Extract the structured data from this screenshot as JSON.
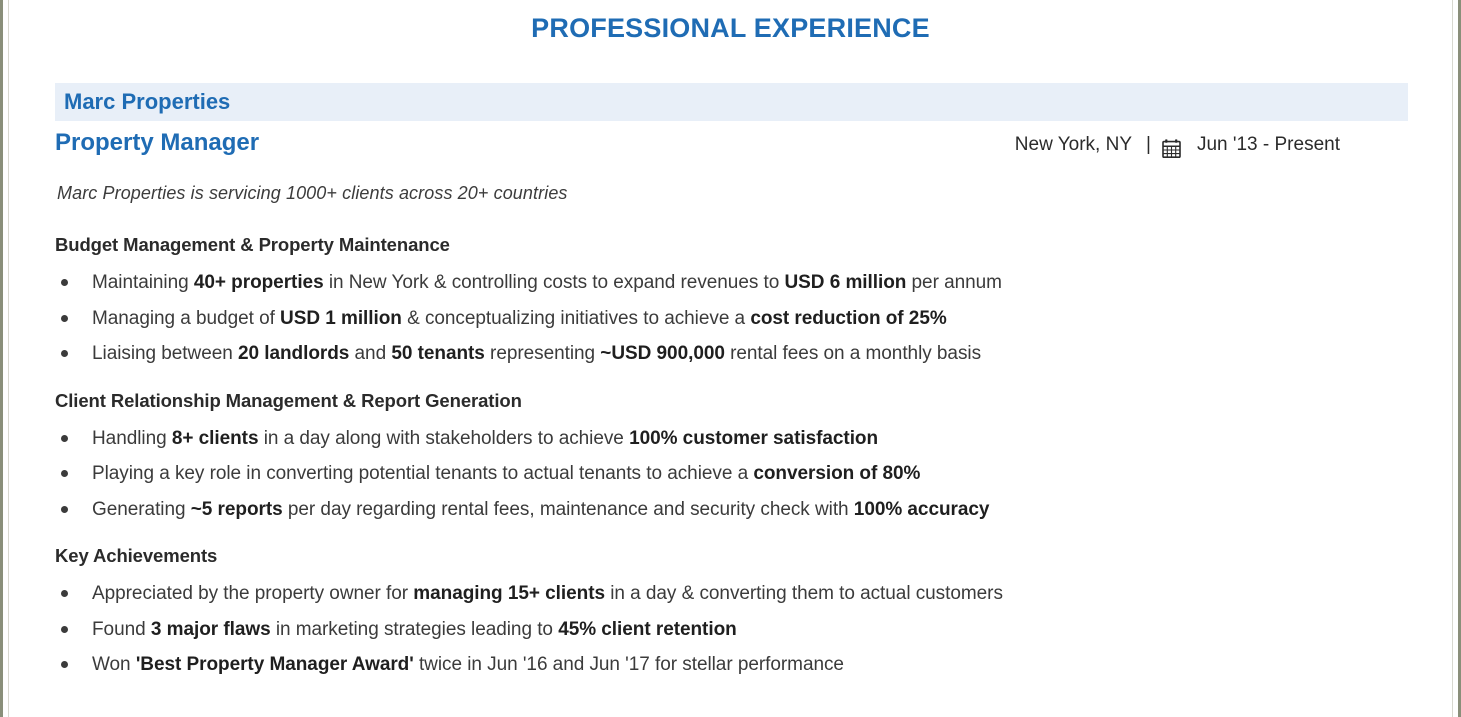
{
  "document": {
    "section_title": "PROFESSIONAL EXPERIENCE",
    "accent_color": "#1f6cb4",
    "company_bar_color": "#e8eff8",
    "company": "Marc Properties",
    "role": "Property Manager",
    "location": "New York, NY",
    "separator": "|",
    "calendar_icon": "calendar-icon",
    "dates": "Jun '13 -  Present",
    "tagline": "Marc Properties is servicing 1000+ clients across 20+ countries",
    "blocks": [
      {
        "heading": "Budget Management & Property Maintenance",
        "bullets": [
          [
            {
              "t": "Maintaining ",
              "b": false
            },
            {
              "t": "40+ properties",
              "b": true
            },
            {
              "t": " in New York & controlling costs to expand revenues to ",
              "b": false
            },
            {
              "t": "USD 6 million",
              "b": true
            },
            {
              "t": " per annum",
              "b": false
            }
          ],
          [
            {
              "t": "Managing a budget of ",
              "b": false
            },
            {
              "t": "USD 1 million",
              "b": true
            },
            {
              "t": " & conceptualizing initiatives to achieve a ",
              "b": false
            },
            {
              "t": "cost reduction of 25%",
              "b": true
            }
          ],
          [
            {
              "t": "Liaising between ",
              "b": false
            },
            {
              "t": "20 landlords",
              "b": true
            },
            {
              "t": " and ",
              "b": false
            },
            {
              "t": "50 tenants",
              "b": true
            },
            {
              "t": " representing ",
              "b": false
            },
            {
              "t": "~USD 900,000",
              "b": true
            },
            {
              "t": " rental fees on a monthly basis",
              "b": false
            }
          ]
        ]
      },
      {
        "heading": "Client Relationship Management & Report Generation",
        "bullets": [
          [
            {
              "t": "Handling ",
              "b": false
            },
            {
              "t": "8+ clients",
              "b": true
            },
            {
              "t": " in a day along with stakeholders to achieve ",
              "b": false
            },
            {
              "t": "100% customer satisfaction",
              "b": true
            }
          ],
          [
            {
              "t": "Playing a key role in converting potential tenants to actual tenants to achieve a ",
              "b": false
            },
            {
              "t": "conversion of 80%",
              "b": true
            }
          ],
          [
            {
              "t": "Generating ",
              "b": false
            },
            {
              "t": "~5 reports",
              "b": true
            },
            {
              "t": " per day regarding rental fees, maintenance and security check with ",
              "b": false
            },
            {
              "t": "100% accuracy",
              "b": true
            }
          ]
        ]
      },
      {
        "heading": "Key Achievements",
        "bullets": [
          [
            {
              "t": "Appreciated by the property owner for ",
              "b": false
            },
            {
              "t": "managing 15+ clients",
              "b": true
            },
            {
              "t": " in a day & converting them to actual customers",
              "b": false
            }
          ],
          [
            {
              "t": "Found ",
              "b": false
            },
            {
              "t": "3 major flaws",
              "b": true
            },
            {
              "t": " in marketing strategies leading to ",
              "b": false
            },
            {
              "t": "45% client retention",
              "b": true
            }
          ],
          [
            {
              "t": "Won ",
              "b": false
            },
            {
              "t": "'Best Property Manager Award'",
              "b": true
            },
            {
              "t": " twice in Jun '16 and Jun '17 for stellar performance",
              "b": false
            }
          ]
        ]
      }
    ]
  }
}
